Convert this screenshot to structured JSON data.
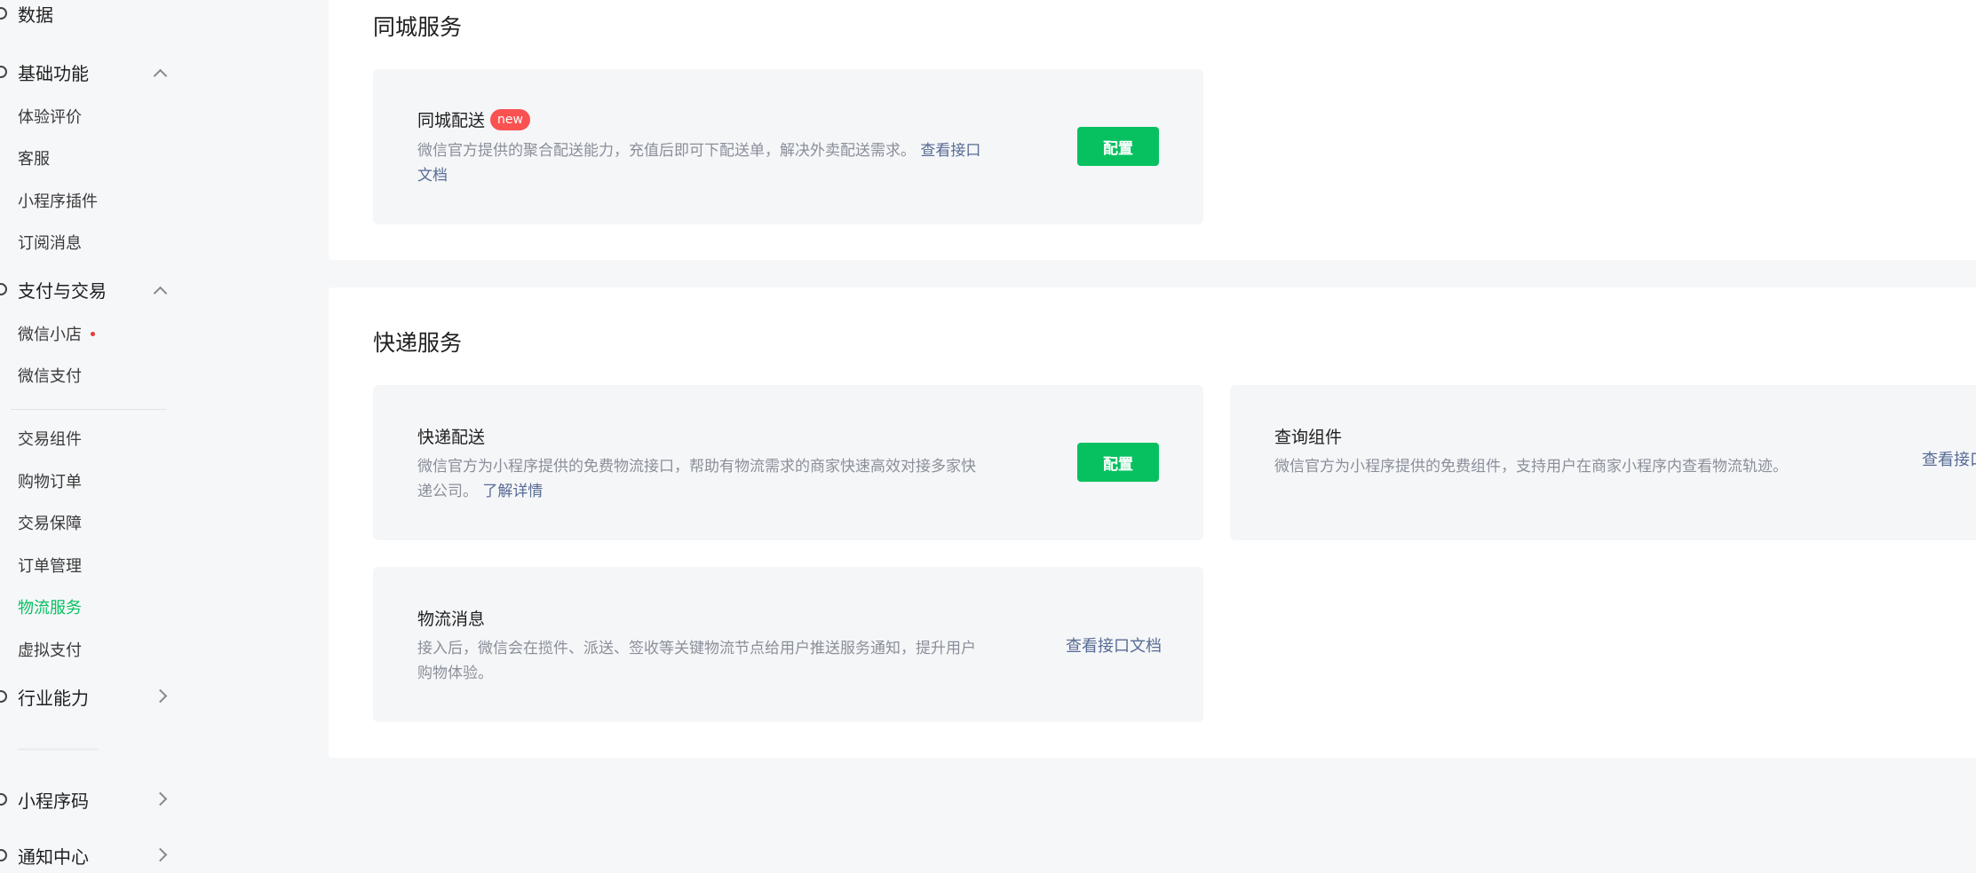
{
  "sidebar": {
    "top_item": "数据",
    "groups": [
      {
        "label": "基础功能",
        "items": [
          "体验评价",
          "客服",
          "小程序插件",
          "订阅消息"
        ]
      },
      {
        "label": "支付与交易",
        "items": [
          "微信小店",
          "微信支付",
          "交易组件",
          "购物订单",
          "交易保障",
          "订单管理",
          "物流服务",
          "虚拟支付"
        ],
        "active_item": "物流服务"
      },
      {
        "label": "行业能力"
      },
      {
        "label": "小程序码"
      },
      {
        "label": "通知中心"
      }
    ]
  },
  "same_city": {
    "title": "同城服务",
    "card": {
      "title": "同城配送",
      "badge": "new",
      "desc": "微信官方提供的聚合配送能力，充值后即可下配送单，解决外卖配送需求。",
      "link_line1": "查看接口",
      "link_line2": "文档",
      "button": "配置"
    }
  },
  "express": {
    "title": "快递服务",
    "card_delivery": {
      "title": "快递配送",
      "desc_line1": "微信官方为小程序提供的免费物流接口，帮助有物流需求的商家快速高效对接多家快",
      "desc_line2": "递公司。",
      "link": "了解详情",
      "button": "配置"
    },
    "card_query": {
      "title": "查询组件",
      "desc": "微信官方为小程序提供的免费组件，支持用户在商家小程序内查看物流轨迹。",
      "link": "查看接口"
    },
    "card_message": {
      "title": "物流消息",
      "desc_line1": "接入后，微信会在揽件、派送、签收等关键物流节点给用户推送服务通知，提升用户",
      "desc_line2": "购物体验。",
      "link": "查看接口文档"
    }
  }
}
